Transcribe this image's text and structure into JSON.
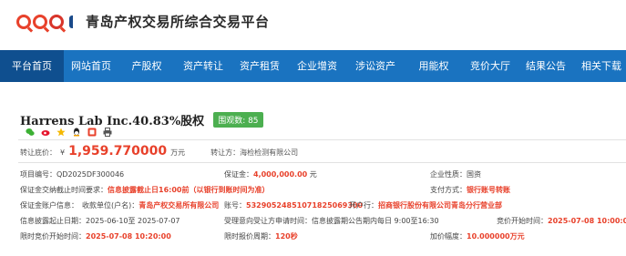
{
  "brand": {
    "name": "青岛产权交易所综合交易平台",
    "logo_text": "QDQ"
  },
  "nav": {
    "items": [
      {
        "label": "平台首页",
        "active": true
      },
      {
        "label": "网站首页"
      },
      {
        "label": "产股权"
      },
      {
        "label": "资产转让"
      },
      {
        "label": "资产租赁"
      },
      {
        "label": "企业增资"
      },
      {
        "label": "涉讼资产"
      },
      {
        "label": "用能权"
      },
      {
        "label": "竞价大厅"
      },
      {
        "label": "结果公告"
      },
      {
        "label": "相关下载"
      }
    ]
  },
  "project": {
    "title": "Harrens Lab Inc.40.83%股权",
    "views": "围观数: 85",
    "icons": [
      "wechat-icon",
      "weibo-icon",
      "star-icon",
      "qq-icon",
      "share-icon",
      "print-icon"
    ]
  },
  "price": {
    "label": "转让底价：",
    "currency": "¥",
    "value": "1,959.770000",
    "unit": "万元",
    "seller_label": "转让方：",
    "seller": "海检检测有限公司"
  },
  "details": {
    "code_label": "项目编号：",
    "code": "QD2025DF300046",
    "deposit_label": "保证金：",
    "deposit": "4,000,000.00",
    "deposit_unit": "元",
    "nature_label": "企业性质：",
    "nature": "国资",
    "deposit_deadline_label": "保证金交纳截止时间要求：",
    "deposit_deadline": "信息披露截止日16:00前（以银行到账时间为准）",
    "pay_label": "支付方式：",
    "pay": "银行账号转账",
    "account_info_label": "保证金账户信息：",
    "payee_label": "收款单位(户名)：",
    "payee": "青岛产权交易所有限公司",
    "account_label": "账号：",
    "account": "53290524851071825069300",
    "bank_label": "开户行：",
    "bank": "招商银行股份有限公司青岛分行营业部",
    "disclosure_label": "信息披露起止日期：",
    "disclosure": "2025-06-10至 2025-07-07",
    "apply_label": "受理意向受让方申请时间：",
    "apply": "信息披露期公告期内每日 9:00至16:30",
    "bid_start_label": "竞价开始时间：",
    "bid_start": "2025-07-08 10:00:00",
    "limit_start_label": "限时竞价开始时间：",
    "limit_start": "2025-07-08 10:20:00",
    "cycle_label": "限时报价周期：",
    "cycle": "120秒",
    "increment_label": "加价幅度：",
    "increment": "10.000000万元"
  },
  "colors": {
    "nav": "#1a73c0",
    "nav_active": "#0f4f8f",
    "accent_red": "#e8412b",
    "badge_green": "#4caf50"
  }
}
